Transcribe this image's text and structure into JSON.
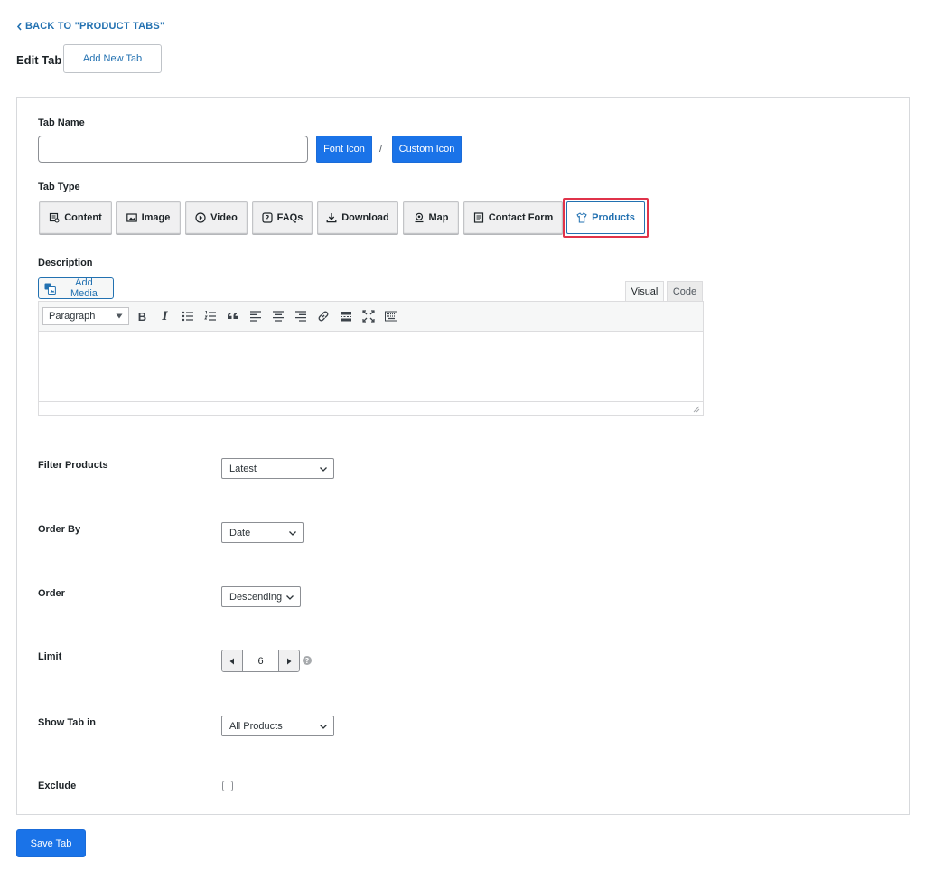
{
  "header": {
    "back_link": "BACK TO \"PRODUCT TABS\"",
    "title": "Edit Tab",
    "add_new_label": "Add New Tab"
  },
  "tab_name": {
    "label": "Tab Name",
    "value": "",
    "font_icon_label": "Font Icon",
    "separator": "/",
    "custom_icon_label": "Custom Icon"
  },
  "tab_type": {
    "label": "Tab Type",
    "selected": "Products",
    "options": [
      {
        "label": "Content",
        "icon": "content-icon"
      },
      {
        "label": "Image",
        "icon": "image-icon"
      },
      {
        "label": "Video",
        "icon": "play-icon"
      },
      {
        "label": "FAQs",
        "icon": "question-icon"
      },
      {
        "label": "Download",
        "icon": "download-icon"
      },
      {
        "label": "Map",
        "icon": "map-pin-icon"
      },
      {
        "label": "Contact Form",
        "icon": "form-icon"
      },
      {
        "label": "Products",
        "icon": "shirt-icon"
      }
    ]
  },
  "description": {
    "label": "Description",
    "add_media_label": "Add Media",
    "tabs": [
      "Visual",
      "Code"
    ],
    "format_label": "Paragraph",
    "toolbar_icons": [
      "bold-icon",
      "italic-icon",
      "bullet-list-icon",
      "numbered-list-icon",
      "blockquote-icon",
      "align-left-icon",
      "align-center-icon",
      "align-right-icon",
      "link-icon",
      "read-more-icon",
      "fullscreen-icon",
      "toolbar-toggle-icon"
    ],
    "bold_glyph": "B",
    "italic_glyph": "I"
  },
  "fields": {
    "filter_products": {
      "label": "Filter Products",
      "value": "Latest"
    },
    "order_by": {
      "label": "Order By",
      "value": "Date"
    },
    "order": {
      "label": "Order",
      "value": "Descending"
    },
    "limit": {
      "label": "Limit",
      "value": "6"
    },
    "show_tab_in": {
      "label": "Show Tab in",
      "value": "All Products"
    },
    "exclude": {
      "label": "Exclude",
      "checked": false
    }
  },
  "footer": {
    "save_label": "Save Tab"
  },
  "colors": {
    "accent": "#2271b1",
    "primary_button": "#1a73e8",
    "highlight": "#e0334a"
  }
}
